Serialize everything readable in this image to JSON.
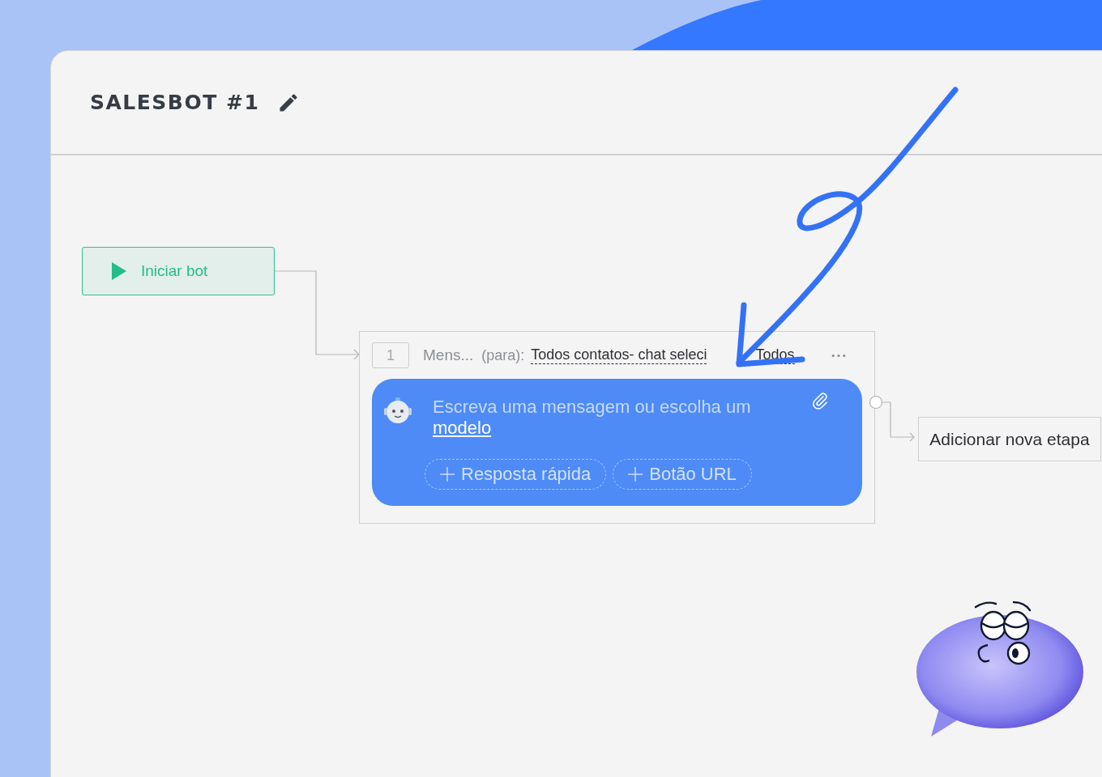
{
  "header": {
    "title": "SALESBOT #1"
  },
  "start_node": {
    "label": "Iniciar bot"
  },
  "step": {
    "number": "1",
    "name": "Mens...",
    "recipient_label": "(para):",
    "recipient_value": "Todos contatos- chat seleci",
    "recipient_value_end": "Todos",
    "message": {
      "placeholder": "Escreva uma mensagem ou escolha um",
      "link": "modelo"
    },
    "buttons": [
      "Resposta rápida",
      "Botão URL"
    ]
  },
  "add_step": {
    "label": "Adicionar nova etapa"
  }
}
